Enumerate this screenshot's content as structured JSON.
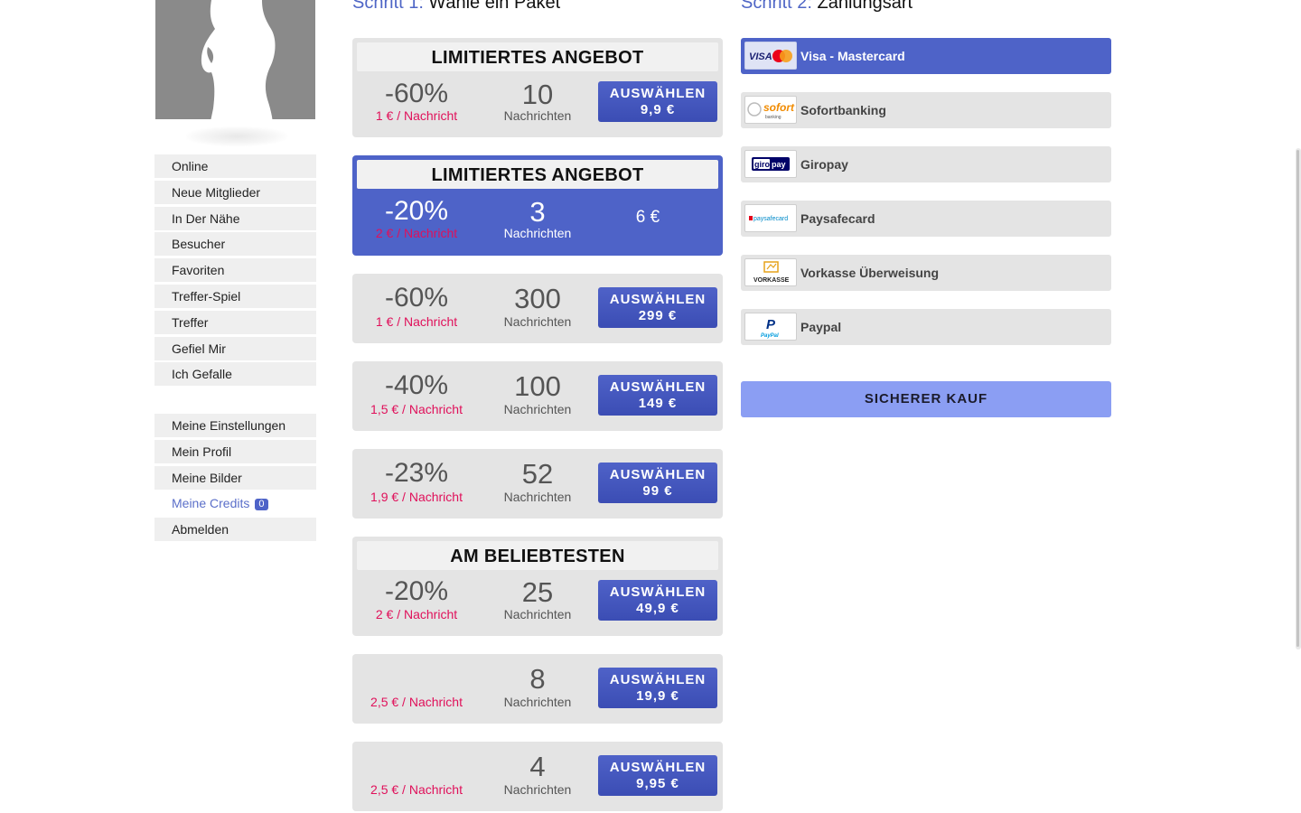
{
  "steps": {
    "step1_label": "Schritt 1:",
    "step1_title": "Wähle ein Paket",
    "step2_label": "Schritt 2:",
    "step2_title": "Zahlungsart"
  },
  "menu_primary": [
    {
      "label": "Online"
    },
    {
      "label": "Neue Mitglieder"
    },
    {
      "label": "In Der Nähe"
    },
    {
      "label": "Besucher"
    },
    {
      "label": "Favoriten"
    },
    {
      "label": "Treffer-Spiel"
    },
    {
      "label": "Treffer"
    },
    {
      "label": "Gefiel Mir"
    },
    {
      "label": "Ich Gefalle"
    }
  ],
  "menu_account": [
    {
      "label": "Meine Einstellungen"
    },
    {
      "label": "Mein Profil"
    },
    {
      "label": "Meine Bilder"
    },
    {
      "label": "Meine Credits",
      "badge": "0"
    },
    {
      "label": "Abmelden"
    }
  ],
  "packages": [
    {
      "label": "LIMITIERTES ANGEBOT",
      "discount": "-60%",
      "per_message": "1 € / Nachricht",
      "count": "10",
      "unit": "Nachrichten",
      "button": "AUSWÄHLEN",
      "price": "9,9 €"
    },
    {
      "label": "LIMITIERTES ANGEBOT",
      "discount": "-20%",
      "per_message": "2 € / Nachricht",
      "count": "3",
      "unit": "Nachrichten",
      "price": "6 €"
    },
    {
      "discount": "-60%",
      "per_message": "1 € / Nachricht",
      "count": "300",
      "unit": "Nachrichten",
      "button": "AUSWÄHLEN",
      "price": "299 €"
    },
    {
      "discount": "-40%",
      "per_message": "1,5 € / Nachricht",
      "count": "100",
      "unit": "Nachrichten",
      "button": "AUSWÄHLEN",
      "price": "149 €"
    },
    {
      "discount": "-23%",
      "per_message": "1,9 € / Nachricht",
      "count": "52",
      "unit": "Nachrichten",
      "button": "AUSWÄHLEN",
      "price": "99 €"
    },
    {
      "label": "AM BELIEBTESTEN",
      "discount": "-20%",
      "per_message": "2 € / Nachricht",
      "count": "25",
      "unit": "Nachrichten",
      "button": "AUSWÄHLEN",
      "price": "49,9 €"
    },
    {
      "per_message": "2,5 € / Nachricht",
      "count": "8",
      "unit": "Nachrichten",
      "button": "AUSWÄHLEN",
      "price": "19,9 €"
    },
    {
      "per_message": "2,5 € / Nachricht",
      "count": "4",
      "unit": "Nachrichten",
      "button": "AUSWÄHLEN",
      "price": "9,95 €"
    }
  ],
  "payment_methods": [
    {
      "name": "Visa - Mastercard",
      "logo_text": "VISA",
      "selected": true
    },
    {
      "name": "Sofortbanking",
      "logo_text": "sofort",
      "logo_subtext": "banking"
    },
    {
      "name": "Giropay",
      "logo_text": "giro",
      "logo_text2": "pay"
    },
    {
      "name": "Paysafecard",
      "logo_text": "paysafecard"
    },
    {
      "name": "Vorkasse Überweisung",
      "logo_text": "VORKASSE"
    },
    {
      "name": "Paypal",
      "logo_text": "P",
      "logo_subtext": "PayPal"
    }
  ],
  "secure_button": "SICHERER KAUF",
  "colors": {
    "accent": "#4e63c8",
    "secure_button": "#8b9ef3",
    "price_per_message": "#e0105a",
    "package_bg": "#e4e4e4"
  }
}
